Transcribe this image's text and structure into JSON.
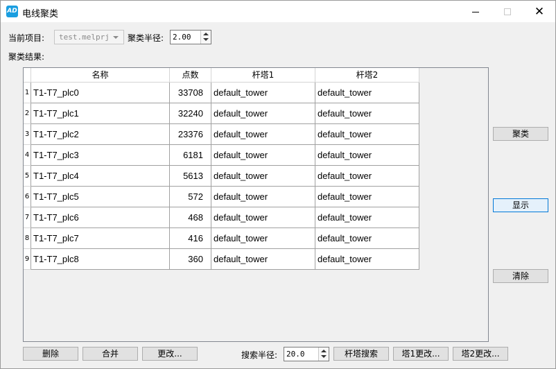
{
  "window": {
    "title": "电线聚类",
    "icon_text": "AD"
  },
  "project": {
    "label": "当前项目:",
    "value": "test.melprj"
  },
  "radius": {
    "label": "聚类半径:",
    "value": "2.00"
  },
  "results_label": "聚类结果:",
  "table": {
    "columns": [
      "名称",
      "点数",
      "杆塔1",
      "杆塔2"
    ],
    "rows": [
      {
        "num": "1",
        "name": "T1-T7_plc0",
        "points": "33708",
        "tower1": "default_tower",
        "tower2": "default_tower"
      },
      {
        "num": "2",
        "name": "T1-T7_plc1",
        "points": "32240",
        "tower1": "default_tower",
        "tower2": "default_tower"
      },
      {
        "num": "3",
        "name": "T1-T7_plc2",
        "points": "23376",
        "tower1": "default_tower",
        "tower2": "default_tower"
      },
      {
        "num": "4",
        "name": "T1-T7_plc3",
        "points": "6181",
        "tower1": "default_tower",
        "tower2": "default_tower"
      },
      {
        "num": "5",
        "name": "T1-T7_plc4",
        "points": "5613",
        "tower1": "default_tower",
        "tower2": "default_tower"
      },
      {
        "num": "6",
        "name": "T1-T7_plc5",
        "points": "572",
        "tower1": "default_tower",
        "tower2": "default_tower"
      },
      {
        "num": "7",
        "name": "T1-T7_plc6",
        "points": "468",
        "tower1": "default_tower",
        "tower2": "default_tower"
      },
      {
        "num": "8",
        "name": "T1-T7_plc7",
        "points": "416",
        "tower1": "default_tower",
        "tower2": "default_tower"
      },
      {
        "num": "9",
        "name": "T1-T7_plc8",
        "points": "360",
        "tower1": "default_tower",
        "tower2": "default_tower"
      }
    ]
  },
  "side_buttons": {
    "cluster": "聚类",
    "show": "显示",
    "clear": "清除"
  },
  "bottom": {
    "delete": "删除",
    "merge": "合并",
    "change": "更改...",
    "search_label": "搜索半径:",
    "search_value": "20.0",
    "tower_search": "杆塔搜索",
    "tower1_change": "塔1更改...",
    "tower2_change": "塔2更改..."
  }
}
